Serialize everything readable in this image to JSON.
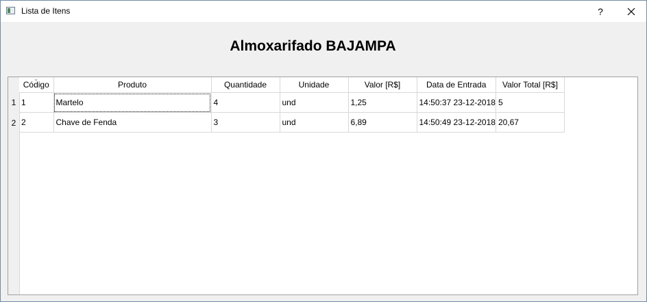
{
  "window": {
    "title": "Lista de Itens",
    "help_label": "?",
    "app_icon": "window-app-icon",
    "close_icon": "close-icon"
  },
  "page": {
    "title": "Almoxarifado BAJAMPA"
  },
  "table": {
    "columns": [
      "Código",
      "Produto",
      "Quantidade",
      "Unidade",
      "Valor [R$]",
      "Data de Entrada",
      "Valor Total [R$]"
    ],
    "sorted_column": "Código",
    "row_numbers": [
      "1",
      "2"
    ],
    "rows": [
      [
        "1",
        "Martelo",
        "4",
        "und",
        "1,25",
        "14:50:37 23-12-2018",
        "5"
      ],
      [
        "2",
        "Chave de Fenda",
        "3",
        "und",
        "6,89",
        "14:50:49 23-12-2018",
        "20,67"
      ]
    ],
    "focused_cell": "Martelo"
  }
}
